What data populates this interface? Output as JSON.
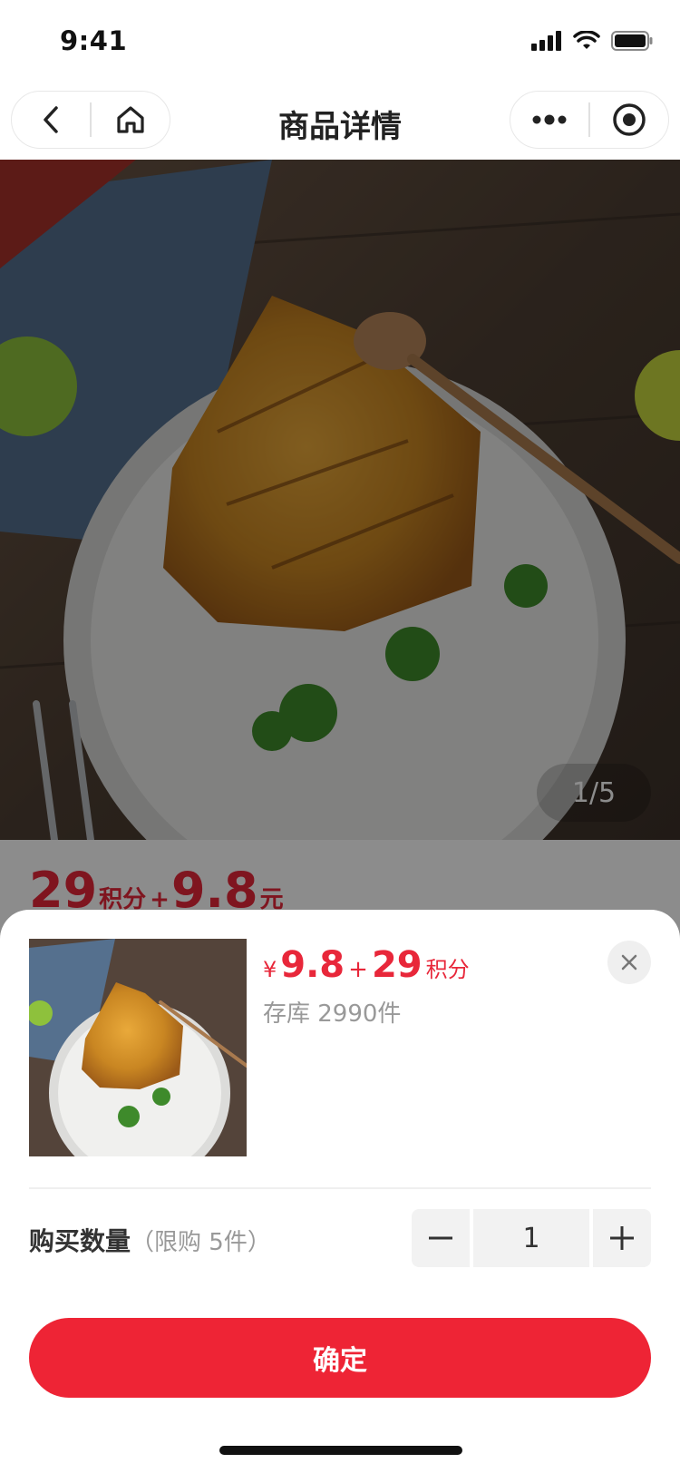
{
  "status_bar": {
    "time": "9:41"
  },
  "nav": {
    "title": "商品详情"
  },
  "gallery": {
    "indicator": "1/5"
  },
  "detail": {
    "points_value": "29",
    "points_unit": "积分",
    "plus": "+",
    "cash_value": "9.8",
    "cash_unit": "元"
  },
  "sheet": {
    "currency": "¥",
    "cash_value": "9.8",
    "plus": "+",
    "points_value": "29",
    "points_unit": "积分",
    "stock_text": "存库 2990件",
    "quantity_label": "购买数量",
    "quantity_limit": "（限购 5件）",
    "quantity_value": "1",
    "confirm_label": "确定"
  },
  "colors": {
    "accent": "#ee2435",
    "price": "#e8273a"
  },
  "icons": [
    "back-icon",
    "home-icon",
    "more-icon",
    "target-icon",
    "close-icon",
    "minus-icon",
    "plus-icon"
  ]
}
